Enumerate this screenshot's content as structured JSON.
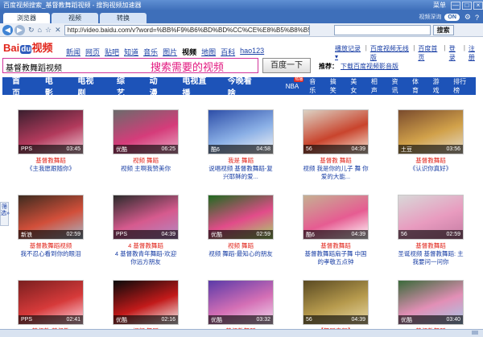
{
  "window": {
    "title": "百度视频搜索_基督教舞蹈视频 - 搜狗视频加速器",
    "menu_label": "菜单",
    "min": "—",
    "max": "□",
    "close": "×"
  },
  "tabs": [
    {
      "label": "浏览器",
      "active": true
    },
    {
      "label": "视频",
      "active": false
    },
    {
      "label": "转换",
      "active": false
    }
  ],
  "toolbar": {
    "fast_label": "视频深询",
    "on_label": "ON",
    "url": "http://video.baidu.com/v?word=%BB%F9%B6%BD%BD%CC%CE%E8%B5%B8%B5%C4%CA%D3%C6%B5",
    "search_label": "搜索"
  },
  "logo": {
    "bai": "Bai",
    "du": "du",
    "video": "视频"
  },
  "topnav": [
    {
      "label": "新闻",
      "current": false
    },
    {
      "label": "网页",
      "current": false
    },
    {
      "label": "贴吧",
      "current": false
    },
    {
      "label": "知道",
      "current": false
    },
    {
      "label": "音乐",
      "current": false
    },
    {
      "label": "图片",
      "current": false
    },
    {
      "label": "视频",
      "current": true
    },
    {
      "label": "地图",
      "current": false
    },
    {
      "label": "百科",
      "current": false
    },
    {
      "label": "hao123",
      "current": false
    }
  ],
  "toplinks": [
    "播放记录 ▾",
    "百度视频无线版",
    "百度首页",
    "登录",
    "注册"
  ],
  "search": {
    "query": "基督教舞蹈视频",
    "hint": "搜索需要的视频",
    "button": "百度一下",
    "rec_label": "推荐：",
    "rec_link": "下载百度视频影音版"
  },
  "categories": [
    "首页",
    "电影",
    "电视剧",
    "综艺",
    "动漫",
    "电视直播",
    "今晚看啥"
  ],
  "subcats": [
    {
      "label": "NBA",
      "badge": "热播"
    },
    {
      "label": "音乐",
      "badge": ""
    },
    {
      "label": "搞笑",
      "badge": ""
    },
    {
      "label": "美女",
      "badge": ""
    },
    {
      "label": "相声",
      "badge": ""
    },
    {
      "label": "资讯",
      "badge": ""
    },
    {
      "label": "体育",
      "badge": ""
    },
    {
      "label": "游戏",
      "badge": ""
    },
    {
      "label": "排行榜",
      "badge": ""
    }
  ],
  "sidetab": "筛选",
  "videos": [
    {
      "source": "PPS",
      "duration": "03:45",
      "title_red": "基督教舞蹈",
      "title": "《主我愿跟随你》",
      "colors": [
        "#3a1f2e",
        "#b23a5c",
        "#f2c9d6"
      ]
    },
    {
      "source": "优酷",
      "duration": "06:25",
      "title_red": "视频 舞蹈",
      "title": "视频 主啊我赞美你",
      "colors": [
        "#6b6b6b",
        "#d53c7a",
        "#e8a9c4"
      ]
    },
    {
      "source": "酷6",
      "duration": "04:58",
      "title_red": "我是 舞蹈",
      "title": "说唱视频 基督教舞蹈-复兴耶稣的爱...",
      "colors": [
        "#2d4ea8",
        "#8bb0e6",
        "#f5f5f5"
      ]
    },
    {
      "source": "56",
      "duration": "04:39",
      "title_red": "基督教 舞蹈",
      "title": "视频 我是你的儿子 舞 你爱的大能...",
      "colors": [
        "#dcd2c4",
        "#c9442d",
        "#f6e9d8"
      ]
    },
    {
      "source": "土豆",
      "duration": "03:56",
      "title_red": "基督教舞蹈",
      "title": "《认识你真好》",
      "colors": [
        "#7a4b2d",
        "#d1a14a",
        "#e5dccb"
      ]
    },
    {
      "source": "新浪",
      "duration": "02:59",
      "title_red": "基督教舞蹈视频",
      "title": "我不忍心看到你的眼泪",
      "colors": [
        "#3d2b1f",
        "#d24f3a",
        "#a7b8c9"
      ]
    },
    {
      "source": "PPS",
      "duration": "04:39",
      "title_red": "4 基督教舞蹈",
      "title": "4 基督教青年舞蹈-欢迎你远方朋友",
      "colors": [
        "#2b2b2b",
        "#d65a8e",
        "#b28bc4"
      ]
    },
    {
      "source": "优酷",
      "duration": "02:59",
      "title_red": "视频 舞蹈",
      "title": "视频 舞蹈-最知心的朋友",
      "colors": [
        "#1f6b1f",
        "#e24c8a",
        "#a6d66b"
      ]
    },
    {
      "source": "酷6",
      "duration": "04:39",
      "title_red": "基督教舞蹈",
      "title": "基督教舞蹈扇子舞 中国的孝敬五点钟",
      "colors": [
        "#c5b092",
        "#e65c92",
        "#ffffff"
      ]
    },
    {
      "source": "56",
      "duration": "02:59",
      "title_red": "基督教舞蹈",
      "title": "圣诞视频 基督教舞蹈: 主我要问一问你",
      "colors": [
        "#d8d8d8",
        "#e89bbf",
        "#c47ba2"
      ]
    },
    {
      "source": "PPS",
      "duration": "02:41",
      "title_red": "基督教 基督教",
      "title": "基督教 基督教歌曲 赞美",
      "colors": [
        "#7a1f1f",
        "#d63a3a",
        "#ffd7e4"
      ]
    },
    {
      "source": "优酷",
      "duration": "02:16",
      "title_red": "视频 舞蹈",
      "title": "视频 舞蹈 拯救你的冬天",
      "colors": [
        "#0a0a0a",
        "#c21a1a",
        "#f5f5f5"
      ]
    },
    {
      "source": "优酷",
      "duration": "03:32",
      "title_red": "基督教舞蹈",
      "title": "基督教舞蹈-普天同庆 视频",
      "colors": [
        "#5b3aa8",
        "#d46fb5",
        "#f0d9ee"
      ]
    },
    {
      "source": "56",
      "duration": "04:39",
      "title_red": "【舞蹈专辑】",
      "title": "【舞蹈专辑】基督教舞蹈 唯独是爱...",
      "colors": [
        "#5a4a22",
        "#b69a4d",
        "#e8d8a5"
      ]
    },
    {
      "source": "优酷",
      "duration": "03:40",
      "title_red": "基督教舞蹈",
      "title": "基督教舞蹈 全能真神",
      "colors": [
        "#3a6a3a",
        "#e28fb6",
        "#a7c9e9"
      ]
    }
  ]
}
